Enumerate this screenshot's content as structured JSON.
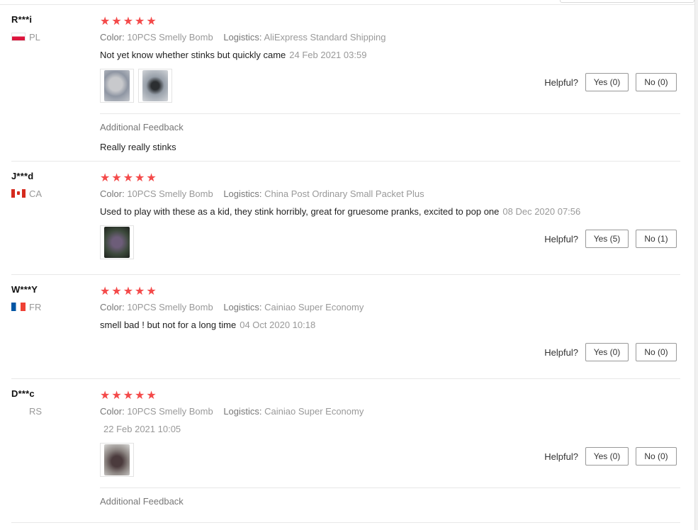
{
  "labels": {
    "color": "Color:",
    "logistics": "Logistics:",
    "helpful": "Helpful?",
    "additional_feedback": "Additional Feedback"
  },
  "colors": {
    "star": "#f44a4a",
    "muted": "#999999"
  },
  "reviews": [
    {
      "user": "R***i",
      "country": "PL",
      "rating": 5,
      "stars": "★★★★★",
      "color": "10PCS Smelly Bomb",
      "logistics": "AliExpress Standard Shipping",
      "text": "Not yet know whether stinks but quickly came",
      "date": "24 Feb 2021 03:59",
      "yes": "Yes (0)",
      "no": "No (0)",
      "additional_feedback": "Really really stinks"
    },
    {
      "user": "J***d",
      "country": "CA",
      "rating": 5,
      "stars": "★★★★★",
      "color": "10PCS Smelly Bomb",
      "logistics": "China Post Ordinary Small Packet Plus",
      "text": "Used to play with these as a kid, they stink horribly, great for gruesome pranks, excited to pop one",
      "date": "08 Dec 2020 07:56",
      "yes": "Yes (5)",
      "no": "No (1)"
    },
    {
      "user": "W***Y",
      "country": "FR",
      "rating": 5,
      "stars": "★★★★★",
      "color": "10PCS Smelly Bomb",
      "logistics": "Cainiao Super Economy",
      "text": "smell bad ! but not for a long time",
      "date": "04 Oct 2020 10:18",
      "yes": "Yes (0)",
      "no": "No (0)"
    },
    {
      "user": "D***c",
      "country": "RS",
      "rating": 5,
      "stars": "★★★★★",
      "color": "10PCS Smelly Bomb",
      "logistics": "Cainiao Super Economy",
      "text": "",
      "date": "22 Feb 2021 10:05",
      "yes": "Yes (0)",
      "no": "No (0)"
    }
  ]
}
